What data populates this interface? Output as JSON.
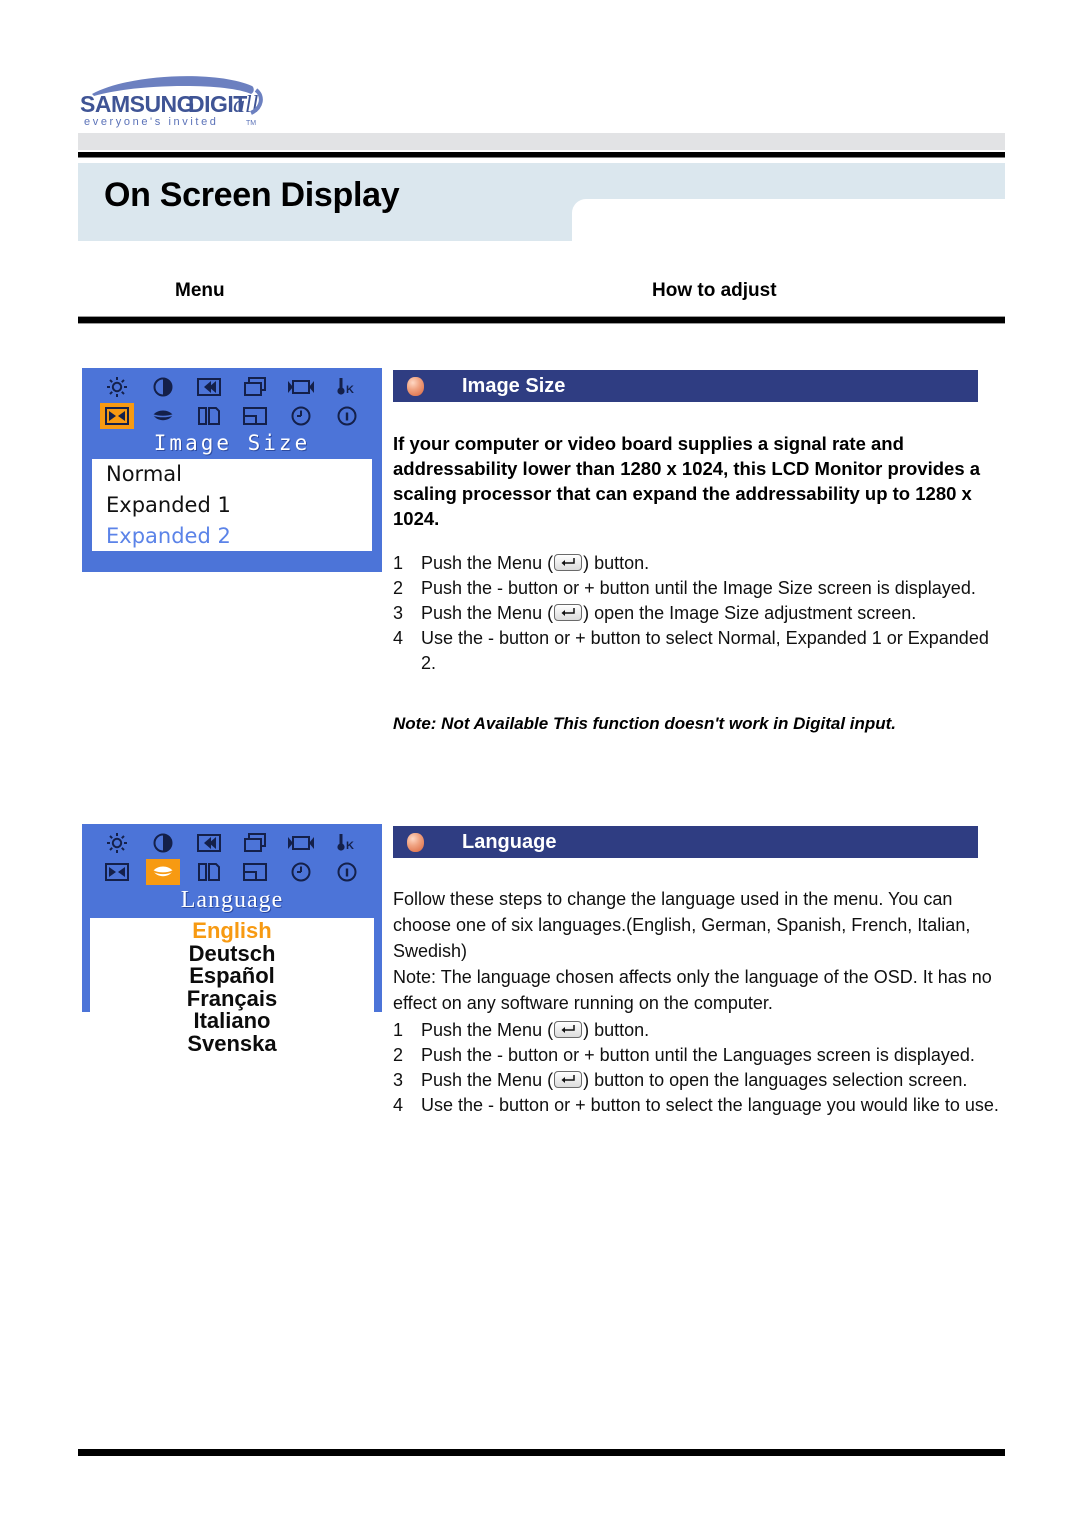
{
  "brand": {
    "name": "SAMSUNG DIGITall",
    "tagline": "everyone's invited",
    "tagline_tm": "TM"
  },
  "header": {
    "page_title": "On Screen Display",
    "columns": {
      "menu": "Menu",
      "how_to_adjust": "How to adjust"
    }
  },
  "sections": [
    {
      "id": "image-size",
      "bar_title": "Image Size",
      "osd": {
        "title": "Image Size",
        "icons_row1": [
          "brightness-icon",
          "contrast-icon",
          "h-position-icon",
          "v-position-icon",
          "image-lock-icon",
          "color-temperature-icon"
        ],
        "icons_row2": [
          "image-size-icon",
          "language-icon",
          "sharpness-icon",
          "osd-position-icon",
          "osd-time-icon",
          "information-icon"
        ],
        "selected_icon": "image-size-icon",
        "options": [
          {
            "label": "Normal",
            "highlighted": false
          },
          {
            "label": "Expanded 1",
            "highlighted": false
          },
          {
            "label": "Expanded 2",
            "highlighted": true
          }
        ]
      },
      "intro": "If your computer or video board supplies a signal rate and addressability lower than 1280 x 1024, this LCD Monitor provides a scaling processor that can expand the addressability up to 1280 x 1024.",
      "steps": [
        {
          "num": "1",
          "before": "Push the Menu (",
          "key": "menu-enter-icon",
          "after": ") button."
        },
        {
          "num": "2",
          "before": "Push the - button or + button until the Image Size screen is displayed.",
          "key": "",
          "after": ""
        },
        {
          "num": "3",
          "before": "Push the Menu (",
          "key": "menu-enter-icon",
          "after": ") open the Image Size adjustment screen."
        },
        {
          "num": "4",
          "before": "Use the - button or + button to select Normal, Expanded 1 or Expanded 2.",
          "key": "",
          "after": ""
        }
      ],
      "note": "Note: Not Available  This function doesn't work in Digital input."
    },
    {
      "id": "language",
      "bar_title": "Language",
      "osd": {
        "title": "Language",
        "icons_row1": [
          "brightness-icon",
          "contrast-icon",
          "h-position-icon",
          "v-position-icon",
          "image-lock-icon",
          "color-temperature-icon"
        ],
        "icons_row2": [
          "image-size-icon",
          "language-icon",
          "sharpness-icon",
          "osd-position-icon",
          "osd-time-icon",
          "information-icon"
        ],
        "selected_icon": "language-icon",
        "options": [
          {
            "label": "English",
            "highlighted": true
          },
          {
            "label": "Deutsch",
            "highlighted": false
          },
          {
            "label": "Español",
            "highlighted": false
          },
          {
            "label": "Français",
            "highlighted": false
          },
          {
            "label": "Italiano",
            "highlighted": false
          },
          {
            "label": "Svenska",
            "highlighted": false
          }
        ]
      },
      "paragraph": "Follow these steps to change the language used in the menu. You can choose one of six languages.(English, German, Spanish, French, Italian, Swedish)\nNote: The language chosen affects only the language of the OSD. It has no effect on any software running on the computer.",
      "steps": [
        {
          "num": "1",
          "before": "Push the Menu (",
          "key": "menu-enter-icon",
          "after": ") button."
        },
        {
          "num": "2",
          "before": "Push the - button or + button until the Languages screen is displayed.",
          "key": "",
          "after": ""
        },
        {
          "num": "3",
          "before": "Push the Menu (",
          "key": "menu-enter-icon",
          "after": ") button to open the languages selection screen."
        },
        {
          "num": "4",
          "before": "Use the - button or + button to select the language you would like to use.",
          "key": "",
          "after": ""
        }
      ]
    }
  ],
  "colors": {
    "osd_blue": "#4c74d8",
    "osd_highlight_orange": "#f79a12",
    "section_bar_navy": "#2f3d82",
    "title_band_blue": "#dbe7ee",
    "brand_blue": "#5b72b8"
  }
}
